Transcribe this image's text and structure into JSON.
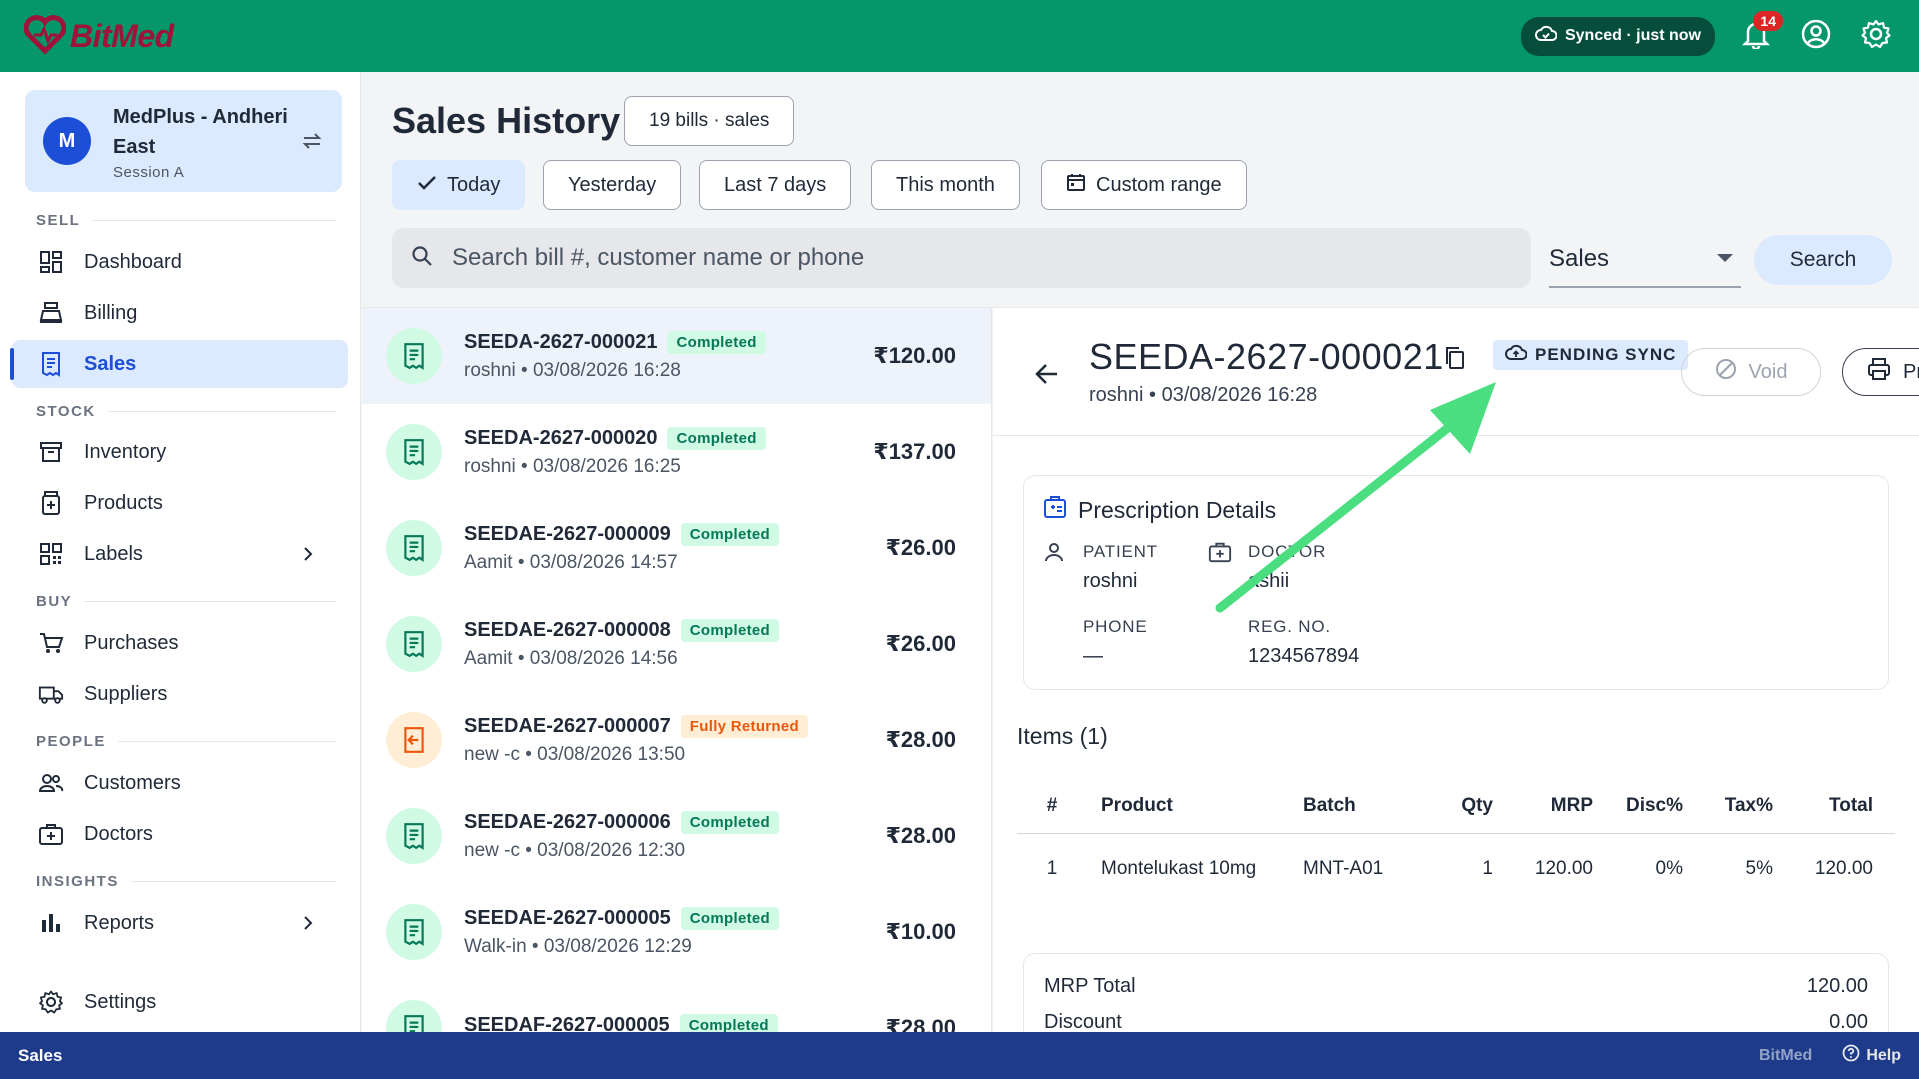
{
  "app": {
    "logo_text": "BitMed",
    "sync_status": "Synced · just now",
    "notification_count": "14"
  },
  "store": {
    "avatar_letter": "M",
    "name": "MedPlus - Andheri East",
    "session": "Session A"
  },
  "sidebar": {
    "sections": {
      "sell": "SELL",
      "stock": "STOCK",
      "buy": "BUY",
      "people": "PEOPLE",
      "insights": "INSIGHTS"
    },
    "items": {
      "dashboard": "Dashboard",
      "billing": "Billing",
      "sales": "Sales",
      "inventory": "Inventory",
      "products": "Products",
      "labels": "Labels",
      "purchases": "Purchases",
      "suppliers": "Suppliers",
      "customers": "Customers",
      "doctors": "Doctors",
      "reports": "Reports",
      "settings": "Settings"
    },
    "active": "sales"
  },
  "header": {
    "title": "Sales History",
    "count_pill": "19 bills · sales",
    "filters": {
      "today": "Today",
      "yesterday": "Yesterday",
      "last7": "Last 7 days",
      "month": "This month",
      "custom": "Custom range"
    },
    "active_filter": "today",
    "search_placeholder": "Search bill #, customer name or phone",
    "search_value": "",
    "type_select": "Sales",
    "search_button": "Search"
  },
  "bills": [
    {
      "number": "SEEDA-2627-000021",
      "status": "Completed",
      "sub": "roshni • 03/08/2026 16:28",
      "amount": "₹120.00",
      "returned": false,
      "selected": true
    },
    {
      "number": "SEEDA-2627-000020",
      "status": "Completed",
      "sub": "roshni • 03/08/2026 16:25",
      "amount": "₹137.00",
      "returned": false,
      "selected": false
    },
    {
      "number": "SEEDAE-2627-000009",
      "status": "Completed",
      "sub": "Aamit • 03/08/2026 14:57",
      "amount": "₹26.00",
      "returned": false,
      "selected": false
    },
    {
      "number": "SEEDAE-2627-000008",
      "status": "Completed",
      "sub": "Aamit • 03/08/2026 14:56",
      "amount": "₹26.00",
      "returned": false,
      "selected": false
    },
    {
      "number": "SEEDAE-2627-000007",
      "status": "Fully Returned",
      "sub": "new -c • 03/08/2026 13:50",
      "amount": "₹28.00",
      "returned": true,
      "selected": false
    },
    {
      "number": "SEEDAE-2627-000006",
      "status": "Completed",
      "sub": "new -c • 03/08/2026 12:30",
      "amount": "₹28.00",
      "returned": false,
      "selected": false
    },
    {
      "number": "SEEDAE-2627-000005",
      "status": "Completed",
      "sub": "Walk-in • 03/08/2026 12:29",
      "amount": "₹10.00",
      "returned": false,
      "selected": false
    },
    {
      "number": "SEEDAF-2627-000005",
      "status": "Completed",
      "sub": "",
      "amount": "₹28.00",
      "returned": false,
      "selected": false
    }
  ],
  "detail": {
    "bill_number": "SEEDA-2627-000021",
    "sub": "roshni • 03/08/2026 16:28",
    "sync_chip": "PENDING SYNC",
    "void_label": "Void",
    "print_label": "Print",
    "prescription": {
      "title": "Prescription Details",
      "patient_label": "PATIENT",
      "patient_value": "roshni",
      "doctor_label": "DOCTOR",
      "doctor_value": "ashii",
      "phone_label": "PHONE",
      "phone_value": "—",
      "reg_label": "REG. NO.",
      "reg_value": "1234567894"
    },
    "items_title": "Items (1)",
    "items_columns": {
      "num": "#",
      "product": "Product",
      "batch": "Batch",
      "qty": "Qty",
      "mrp": "MRP",
      "disc": "Disc%",
      "tax": "Tax%",
      "total": "Total"
    },
    "items": [
      {
        "num": "1",
        "product": "Montelukast 10mg",
        "batch": "MNT-A01",
        "qty": "1",
        "mrp": "120.00",
        "disc": "0%",
        "tax": "5%",
        "total": "120.00"
      }
    ],
    "totals": {
      "mrp_total_label": "MRP Total",
      "mrp_total_value": "120.00",
      "discount_label": "Discount",
      "discount_value": "0.00"
    }
  },
  "bottombar": {
    "title": "Sales",
    "brand": "BitMed",
    "help": "Help"
  },
  "colors": {
    "topbar": "#059669",
    "accent": "#1d4ed8",
    "completed": "#047857",
    "returned": "#ea580c",
    "annotation_arrow": "#4ade80"
  }
}
